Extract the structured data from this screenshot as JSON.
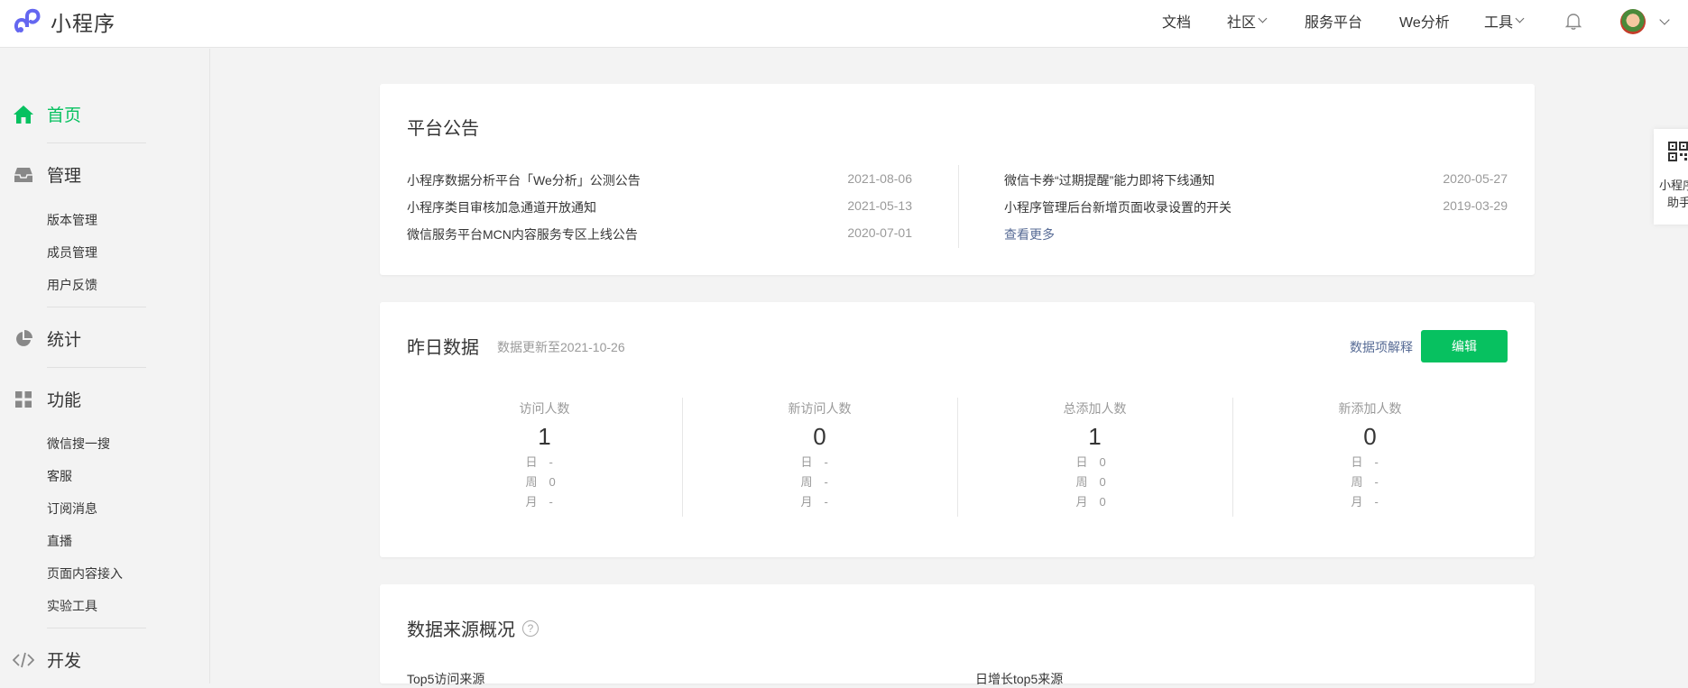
{
  "app": {
    "title": "小程序"
  },
  "topnav": {
    "docs": "文档",
    "community": "社区",
    "service": "服务平台",
    "analytics": "We分析",
    "tools": "工具"
  },
  "sidebar": {
    "home": "首页",
    "manage": "管理",
    "manage_items": [
      "版本管理",
      "成员管理",
      "用户反馈"
    ],
    "stats": "统计",
    "features": "功能",
    "feature_items": [
      "微信搜一搜",
      "客服",
      "订阅消息",
      "直播",
      "页面内容接入",
      "实验工具"
    ],
    "dev": "开发"
  },
  "announcements": {
    "title": "平台公告",
    "left": [
      {
        "text": "小程序数据分析平台「We分析」公测公告",
        "date": "2021-08-06"
      },
      {
        "text": "小程序类目审核加急通道开放通知",
        "date": "2021-05-13"
      },
      {
        "text": "微信服务平台MCN内容服务专区上线公告",
        "date": "2020-07-01"
      }
    ],
    "right": [
      {
        "text": "微信卡券“过期提醒”能力即将下线通知",
        "date": "2020-05-27"
      },
      {
        "text": "小程序管理后台新增页面收录设置的开关",
        "date": "2019-03-29"
      }
    ],
    "more": "查看更多"
  },
  "yesterday": {
    "title": "昨日数据",
    "updated": "数据更新至2021-10-26",
    "explain": "数据项解释",
    "edit": "编辑",
    "sub_labels": [
      "日",
      "周",
      "月"
    ],
    "stats": [
      {
        "label": "访问人数",
        "value": "1",
        "day": "-",
        "week": "0",
        "month": "-"
      },
      {
        "label": "新访问人数",
        "value": "0",
        "day": "-",
        "week": "-",
        "month": "-"
      },
      {
        "label": "总添加人数",
        "value": "1",
        "day": "0",
        "week": "0",
        "month": "0"
      },
      {
        "label": "新添加人数",
        "value": "0",
        "day": "-",
        "week": "-",
        "month": "-"
      }
    ]
  },
  "sources": {
    "title": "数据来源概况",
    "top5": "Top5访问来源",
    "growth": "日增长top5来源"
  },
  "helper": {
    "line1": "小程序",
    "line2": "助手"
  },
  "colors": {
    "accent": "#07c160",
    "link": "#576b95"
  }
}
